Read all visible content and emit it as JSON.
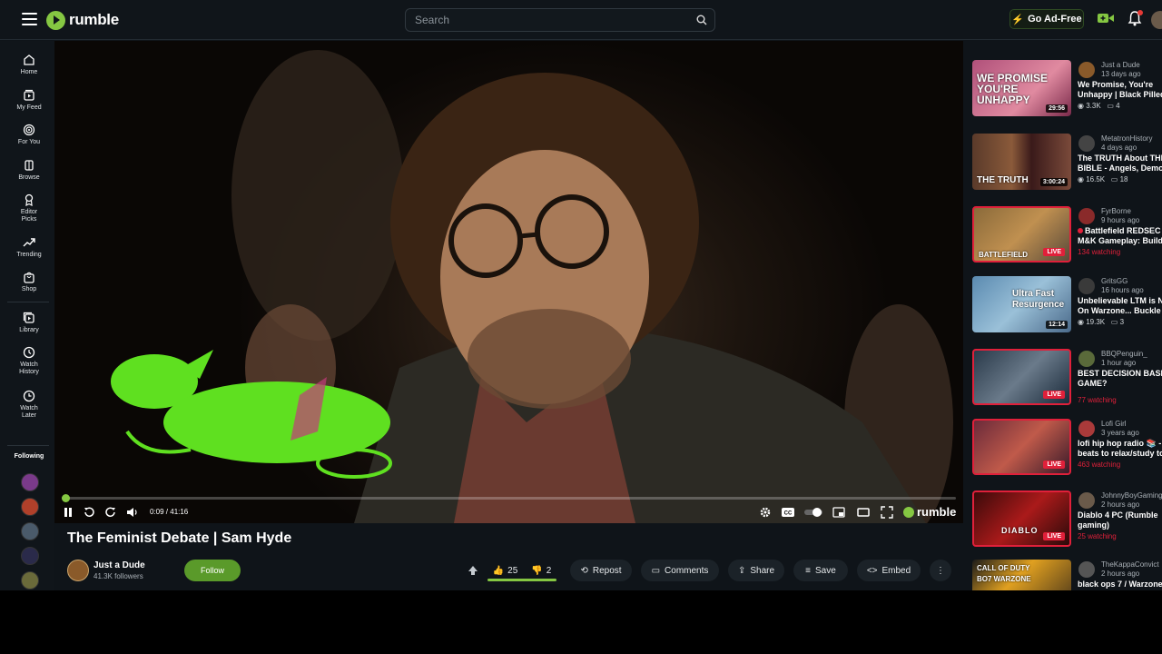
{
  "topbar": {
    "logo_text": "rumble",
    "search_placeholder": "Search",
    "go_ad_free": "Go Ad-Free"
  },
  "sidebar": {
    "items": [
      {
        "label": "Home",
        "icon": "home-icon"
      },
      {
        "label": "My Feed",
        "icon": "feed-icon"
      },
      {
        "label": "For You",
        "icon": "target-icon"
      },
      {
        "label": "Browse",
        "icon": "browse-icon"
      },
      {
        "label": "Editor Picks",
        "icon": "award-icon"
      },
      {
        "label": "Trending",
        "icon": "trending-icon"
      },
      {
        "label": "Shop",
        "icon": "bag-icon"
      },
      {
        "label": "Library",
        "icon": "library-icon"
      },
      {
        "label": "Watch History",
        "icon": "history-icon"
      },
      {
        "label": "Watch Later",
        "icon": "clock-icon"
      }
    ],
    "following_label": "Following"
  },
  "player": {
    "time": "0:09 / 41:16",
    "brand": "rumble",
    "progress_fraction": 0.004
  },
  "video": {
    "title": "The Feminist Debate | Sam Hyde",
    "channel_name": "Just a Dude",
    "followers": "41.3K followers",
    "follow_label": "Follow",
    "likes": "25",
    "dislikes": "2",
    "repost": "Repost",
    "comments": "Comments",
    "share": "Share",
    "save": "Save",
    "embed": "Embed"
  },
  "recommendations": [
    {
      "channel": "Just a Dude",
      "ago": "13 days ago",
      "title": "We Promise, You're Unhappy | Black Pilled",
      "views": "3.3K",
      "comments": "4",
      "duration": "29:56",
      "thumb_text": "WE PROMISE YOU'RE UNHAPPY",
      "live": false
    },
    {
      "channel": "MetatronHistory",
      "ago": "4 days ago",
      "title": "The TRUTH About THE BIBLE - Angels, Demons",
      "views": "16.5K",
      "comments": "18",
      "duration": "3:00:24",
      "thumb_text": "THE TRUTH",
      "live": false
    },
    {
      "channel": "FyrBorne",
      "ago": "9 hours ago",
      "title": "Battlefield REDSEC M&K Gameplay: Build",
      "watching": "134 watching",
      "thumb_text": "BATTLEFIELD",
      "live": true
    },
    {
      "channel": "GritsGG",
      "ago": "16 hours ago",
      "title": "Unbelievable LTM is Now On Warzone... Buckle",
      "views": "19.3K",
      "comments": "3",
      "duration": "12:14",
      "thumb_text": "Ultra Fast Resurgence",
      "live": false
    },
    {
      "channel": "BBQPenguin_",
      "ago": "1 hour ago",
      "title": "BEST DECISION BASED GAME?",
      "watching": "77 watching",
      "thumb_text": "",
      "live": true
    },
    {
      "channel": "Lofi Girl",
      "ago": "3 years ago",
      "title": "lofi hip hop radio 📚 - beats to relax/study to",
      "watching": "463 watching",
      "thumb_text": "",
      "live": true
    },
    {
      "channel": "JohnnyBoyGaming",
      "ago": "2 hours ago",
      "title": "Diablo 4 PC (Rumble gaming)",
      "watching": "25 watching",
      "thumb_text": "DIABLO",
      "live": true
    },
    {
      "channel": "TheKappaConvict",
      "ago": "2 hours ago",
      "title": "black ops 7 / Warzone",
      "thumb_text": "CALL OF DUTY BO7 WARZONE",
      "live": false
    }
  ],
  "colors": {
    "brand_green": "#85c742",
    "live_red": "#e0203a",
    "background": "#0f1419"
  }
}
